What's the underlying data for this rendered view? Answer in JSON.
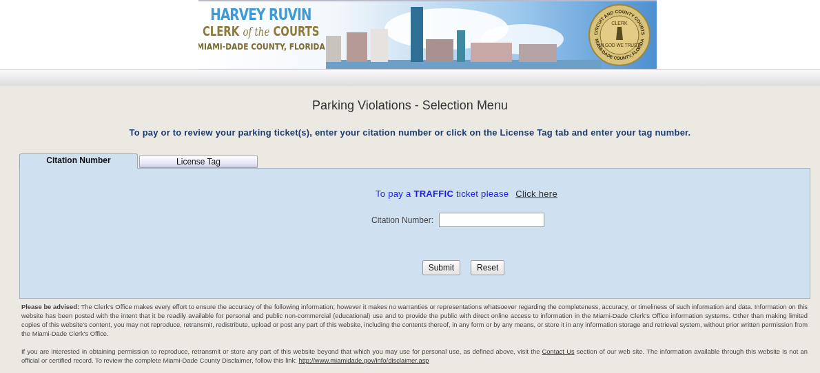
{
  "banner": {
    "name": "HARVEY RUVIN",
    "title_pre": "CLERK",
    "title_mid": "of the",
    "title_post": "COURTS",
    "county": "MIAMI-DADE COUNTY, FLORIDA",
    "seal": {
      "top": "CIRCUIT AND COUNTY COURTS",
      "center": "CLERK",
      "motto": "IN GOD WE TRUST",
      "bottom": "MIAMI-DADE COUNTY, FLORIDA"
    }
  },
  "page_title": "Parking Violations - Selection Menu",
  "instructions": "To pay or to review your parking ticket(s), enter your citation number or click on the License Tag tab and enter your tag number.",
  "tabs": [
    {
      "label": "Citation Number",
      "selected": true
    },
    {
      "label": "License Tag",
      "selected": false
    }
  ],
  "traffic_notice": {
    "text": "To pay a **TRAFFIC** ticket please",
    "link": "Click here"
  },
  "citation_field": {
    "label": "Citation Number:"
  },
  "buttons": [
    "Submit",
    "Reset"
  ],
  "disclaimer": [
    [
      {
        "kind": "text",
        "text": "**Please be advised:**   The Clerk's Office makes every effort to ensure the accuracy of the following information; however it makes no warranties or representations whatsoever regarding the completeness, accuracy, or timeliness of such information and data. Information on this website has been posted with the intent that it be readily available for personal and public non-commercial (educational) use and to provide the public with direct online access to information in the Miami-Dade Clerk's Office information systems. Other than making limited copies of this website's content, you may not reproduce, retransmit, redistribute, upload or post any part of this website, including the contents thereof, in any form or by any means, or store it in any information storage and retrieval system, without prior written permission from the Miami-Dade Clerk's Office."
      }
    ],
    [
      {
        "kind": "text",
        "text": "If you are interested in obtaining permission to reproduce, retransmit or store any part of this website beyond that which you may use for personal use, as defined above, visit the"
      },
      {
        "kind": "link",
        "text": "Contact Us"
      },
      {
        "kind": "text",
        "text": "section of our web site. The information available through this website is not an official or certified record. To review the complete Miami-Dade County Disclaimer, follow this link:"
      },
      {
        "kind": "link",
        "text": "http://www.miamidade.gov/info/disclaimer.asp"
      }
    ]
  ]
}
